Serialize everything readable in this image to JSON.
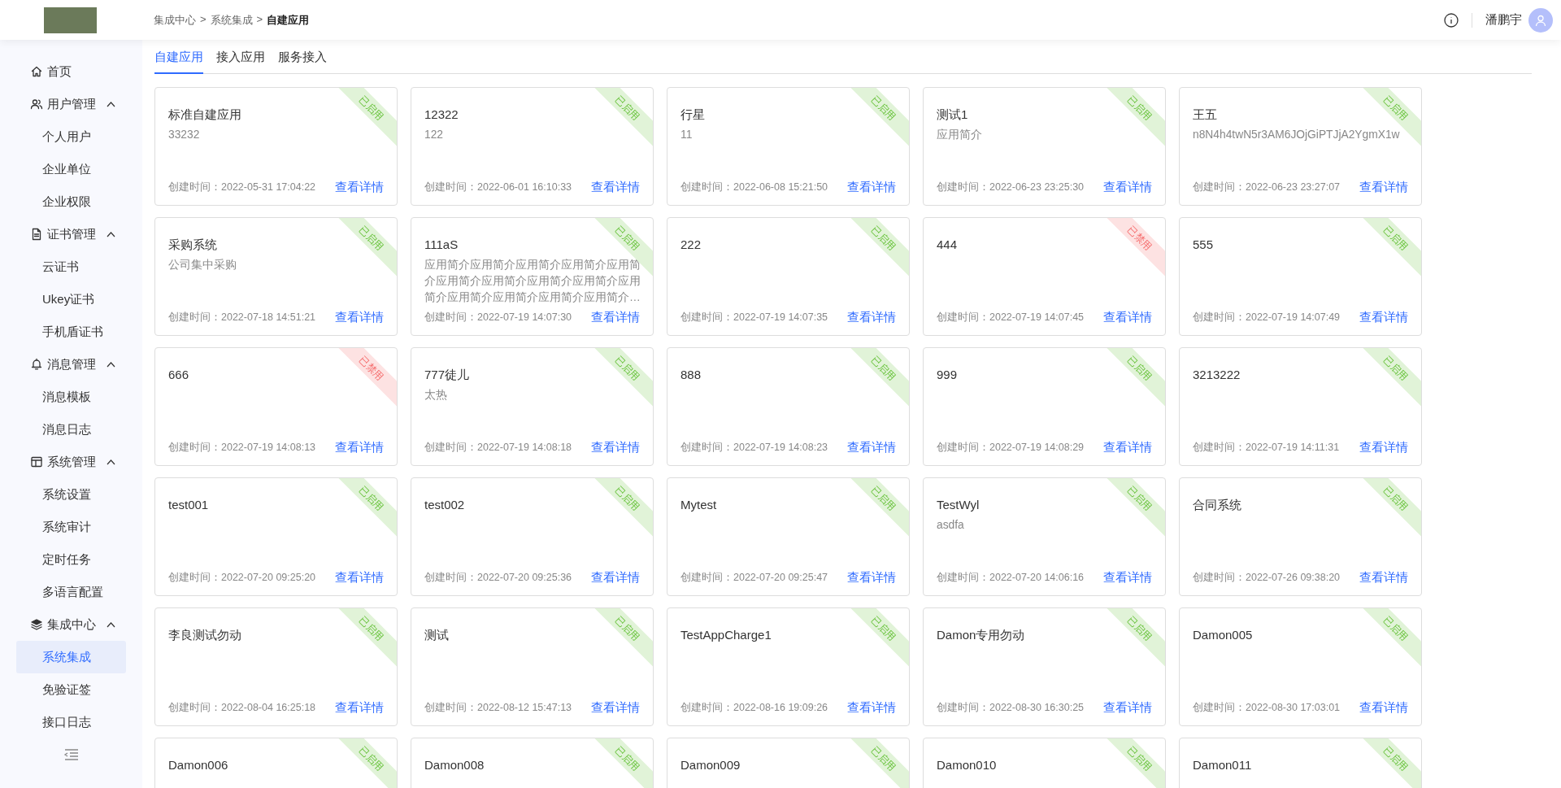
{
  "header": {
    "breadcrumb": [
      "集成中心",
      "系统集成",
      "自建应用"
    ],
    "separator": ">",
    "user": {
      "name": "潘鹏宇"
    }
  },
  "sidebar": {
    "items": [
      {
        "label": "首页",
        "selected": false
      },
      {
        "label": "用户管理",
        "expanded": true,
        "children": [
          {
            "label": "个人用户",
            "selected": false
          },
          {
            "label": "企业单位",
            "selected": false
          },
          {
            "label": "企业权限",
            "selected": false
          }
        ]
      },
      {
        "label": "证书管理",
        "expanded": true,
        "children": [
          {
            "label": "云证书",
            "selected": false
          },
          {
            "label": "Ukey证书",
            "selected": false
          },
          {
            "label": "手机盾证书",
            "selected": false
          }
        ]
      },
      {
        "label": "消息管理",
        "expanded": true,
        "children": [
          {
            "label": "消息模板",
            "selected": false
          },
          {
            "label": "消息日志",
            "selected": false
          }
        ]
      },
      {
        "label": "系统管理",
        "expanded": true,
        "children": [
          {
            "label": "系统设置",
            "selected": false
          },
          {
            "label": "系统审计",
            "selected": false
          },
          {
            "label": "定时任务",
            "selected": false
          },
          {
            "label": "多语言配置",
            "selected": false
          }
        ]
      },
      {
        "label": "集成中心",
        "expanded": true,
        "children": [
          {
            "label": "系统集成",
            "selected": true
          },
          {
            "label": "免验证签",
            "selected": false
          },
          {
            "label": "接口日志",
            "selected": false
          }
        ]
      }
    ]
  },
  "tabs": [
    {
      "label": "自建应用",
      "selected": true
    },
    {
      "label": "接入应用",
      "selected": false
    },
    {
      "label": "服务接入",
      "selected": false
    }
  ],
  "cards": [
    {
      "title": "标准自建应用",
      "description": "33232",
      "created": "创建时间：2022-05-31 17:04:22",
      "link": "查看详情",
      "status": "已启用",
      "enabled": true
    },
    {
      "title": "12322",
      "description": "122",
      "created": "创建时间：2022-06-01 16:10:33",
      "link": "查看详情",
      "status": "已启用",
      "enabled": true
    },
    {
      "title": "行星",
      "description": "11",
      "created": "创建时间：2022-06-08 15:21:50",
      "link": "查看详情",
      "status": "已启用",
      "enabled": true
    },
    {
      "title": "测试1",
      "description": "应用简介",
      "created": "创建时间：2022-06-23 23:25:30",
      "link": "查看详情",
      "status": "已启用",
      "enabled": true
    },
    {
      "title": "王五",
      "description": "n8N4h4twN5r3AM6JOjGiPTJjA2YgmX1w",
      "created": "创建时间：2022-06-23 23:27:07",
      "link": "查看详情",
      "status": "已启用",
      "enabled": true
    },
    {
      "title": "采购系统",
      "description": "公司集中采购",
      "created": "创建时间：2022-07-18 14:51:21",
      "link": "查看详情",
      "status": "已启用",
      "enabled": true
    },
    {
      "title": "111aS",
      "description": "应用简介应用简介应用简介应用简介应用简介应用简介应用简介应用简介应用简介应用简介应用简介应用简介应用简介应用简介…",
      "created": "创建时间：2022-07-19 14:07:30",
      "link": "查看详情",
      "status": "已启用",
      "enabled": true
    },
    {
      "title": "222",
      "created": "创建时间：2022-07-19 14:07:35",
      "link": "查看详情",
      "status": "已启用",
      "enabled": true
    },
    {
      "title": "444",
      "created": "创建时间：2022-07-19 14:07:45",
      "link": "查看详情",
      "status": "已禁用",
      "enabled": false
    },
    {
      "title": "555",
      "created": "创建时间：2022-07-19 14:07:49",
      "link": "查看详情",
      "status": "已启用",
      "enabled": true
    },
    {
      "title": "666",
      "created": "创建时间：2022-07-19 14:08:13",
      "link": "查看详情",
      "status": "已禁用",
      "enabled": false
    },
    {
      "title": "777徒儿",
      "description": "太热",
      "created": "创建时间：2022-07-19 14:08:18",
      "link": "查看详情",
      "status": "已启用",
      "enabled": true
    },
    {
      "title": "888",
      "created": "创建时间：2022-07-19 14:08:23",
      "link": "查看详情",
      "status": "已启用",
      "enabled": true
    },
    {
      "title": "999",
      "created": "创建时间：2022-07-19 14:08:29",
      "link": "查看详情",
      "status": "已启用",
      "enabled": true
    },
    {
      "title": "3213222",
      "created": "创建时间：2022-07-19 14:11:31",
      "link": "查看详情",
      "status": "已启用",
      "enabled": true
    },
    {
      "title": "test001",
      "created": "创建时间：2022-07-20 09:25:20",
      "link": "查看详情",
      "status": "已启用",
      "enabled": true
    },
    {
      "title": "test002",
      "created": "创建时间：2022-07-20 09:25:36",
      "link": "查看详情",
      "status": "已启用",
      "enabled": true
    },
    {
      "title": "Mytest",
      "created": "创建时间：2022-07-20 09:25:47",
      "link": "查看详情",
      "status": "已启用",
      "enabled": true
    },
    {
      "title": "TestWyl",
      "description": "asdfa",
      "created": "创建时间：2022-07-20 14:06:16",
      "link": "查看详情",
      "status": "已启用",
      "enabled": true
    },
    {
      "title": "合同系统",
      "created": "创建时间：2022-07-26 09:38:20",
      "link": "查看详情",
      "status": "已启用",
      "enabled": true
    },
    {
      "title": "李良测试勿动",
      "created": "创建时间：2022-08-04 16:25:18",
      "link": "查看详情",
      "status": "已启用",
      "enabled": true
    },
    {
      "title": "测试",
      "created": "创建时间：2022-08-12 15:47:13",
      "link": "查看详情",
      "status": "已启用",
      "enabled": true
    },
    {
      "title": "TestAppCharge1",
      "created": "创建时间：2022-08-16 19:09:26",
      "link": "查看详情",
      "status": "已启用",
      "enabled": true
    },
    {
      "title": "Damon专用勿动",
      "created": "创建时间：2022-08-30 16:30:25",
      "link": "查看详情",
      "status": "已启用",
      "enabled": true
    },
    {
      "title": "Damon005",
      "created": "创建时间：2022-08-30 17:03:01",
      "link": "查看详情",
      "status": "已启用",
      "enabled": true
    },
    {
      "title": "Damon006",
      "status": "已启用",
      "enabled": true
    },
    {
      "title": "Damon008",
      "status": "已启用",
      "enabled": true
    },
    {
      "title": "Damon009",
      "status": "已启用",
      "enabled": true
    },
    {
      "title": "Damon010",
      "status": "已启用",
      "enabled": true
    },
    {
      "title": "Damon011",
      "status": "已启用",
      "enabled": true
    }
  ]
}
